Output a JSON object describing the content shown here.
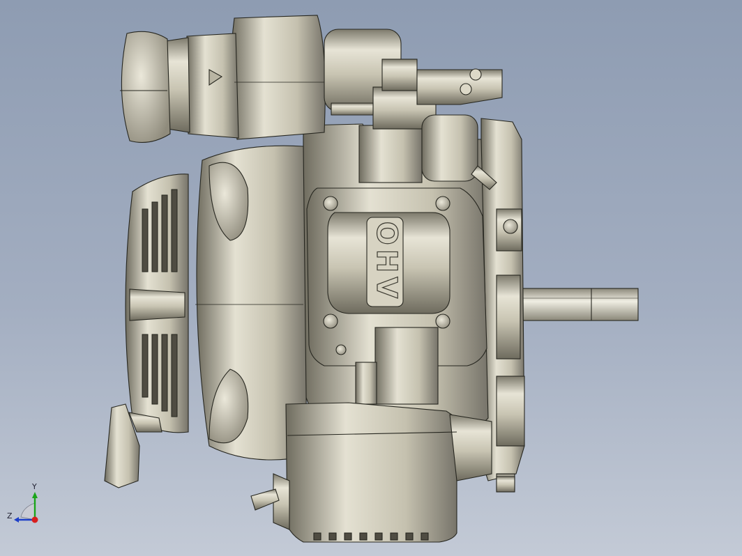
{
  "viewport": {
    "background_top": "#8e9cb2",
    "background_bottom": "#c3cad6",
    "model": {
      "part_color": "#cdc9b7",
      "edge_color": "#26261f",
      "cover_logo_text": "OHV"
    },
    "triad": {
      "y_label": "Y",
      "z_label": "Z",
      "y_color": "#1aa51a",
      "z_color": "#1d3fc8",
      "x_color": "#d81e1e"
    }
  }
}
